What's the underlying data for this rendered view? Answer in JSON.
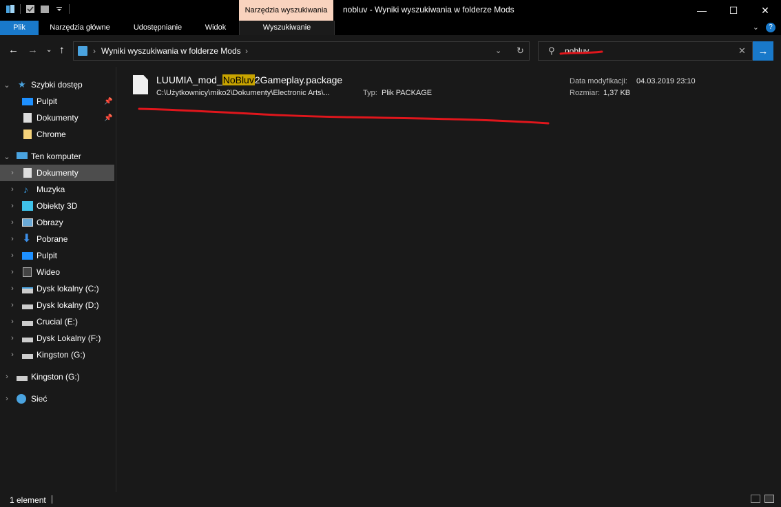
{
  "titlebar": {
    "context_tab": "Narzędzia wyszukiwania",
    "title": "nobluv - Wyniki wyszukiwania w folderze Mods",
    "minimize": "—",
    "maximize": "☐",
    "close": "✕"
  },
  "ribbon": {
    "tabs": [
      "Plik",
      "Narzędzia główne",
      "Udostępnianie",
      "Widok",
      "Wyszukiwanie"
    ],
    "collapse": "⌄",
    "help": "?"
  },
  "address": {
    "crumb": "Wyniki wyszukiwania w folderze Mods",
    "sep": "›"
  },
  "search": {
    "value": "nobluv"
  },
  "sidebar": {
    "quick_access": {
      "label": "Szybki dostęp",
      "items": [
        "Pulpit",
        "Dokumenty",
        "Chrome"
      ]
    },
    "this_pc": {
      "label": "Ten komputer",
      "items": [
        "Dokumenty",
        "Muzyka",
        "Obiekty 3D",
        "Obrazy",
        "Pobrane",
        "Pulpit",
        "Wideo",
        "Dysk lokalny (C:)",
        "Dysk lokalny (D:)",
        "Crucial (E:)",
        "Dysk Lokalny (F:)",
        "Kingston (G:)"
      ]
    },
    "kingston": "Kingston (G:)",
    "network": "Sieć"
  },
  "result": {
    "name_prefix": "LUUMIA_mod_",
    "name_highlight": "NoBluv",
    "name_suffix": "2Gameplay.package",
    "path": "C:\\Użytkownicy\\miko2\\Dokumenty\\Electronic Arts\\...",
    "type_label": "Typ:",
    "type_value": "Plik PACKAGE",
    "modified_label": "Data modyfikacji:",
    "modified_value": "04.03.2019 23:10",
    "size_label": "Rozmiar:",
    "size_value": "1,37 KB"
  },
  "status": {
    "count": "1 element"
  },
  "colors": {
    "accent": "#1979ca",
    "context_tab": "#f9d3be",
    "highlight": "#c8a400",
    "annotation": "#e0161c"
  }
}
